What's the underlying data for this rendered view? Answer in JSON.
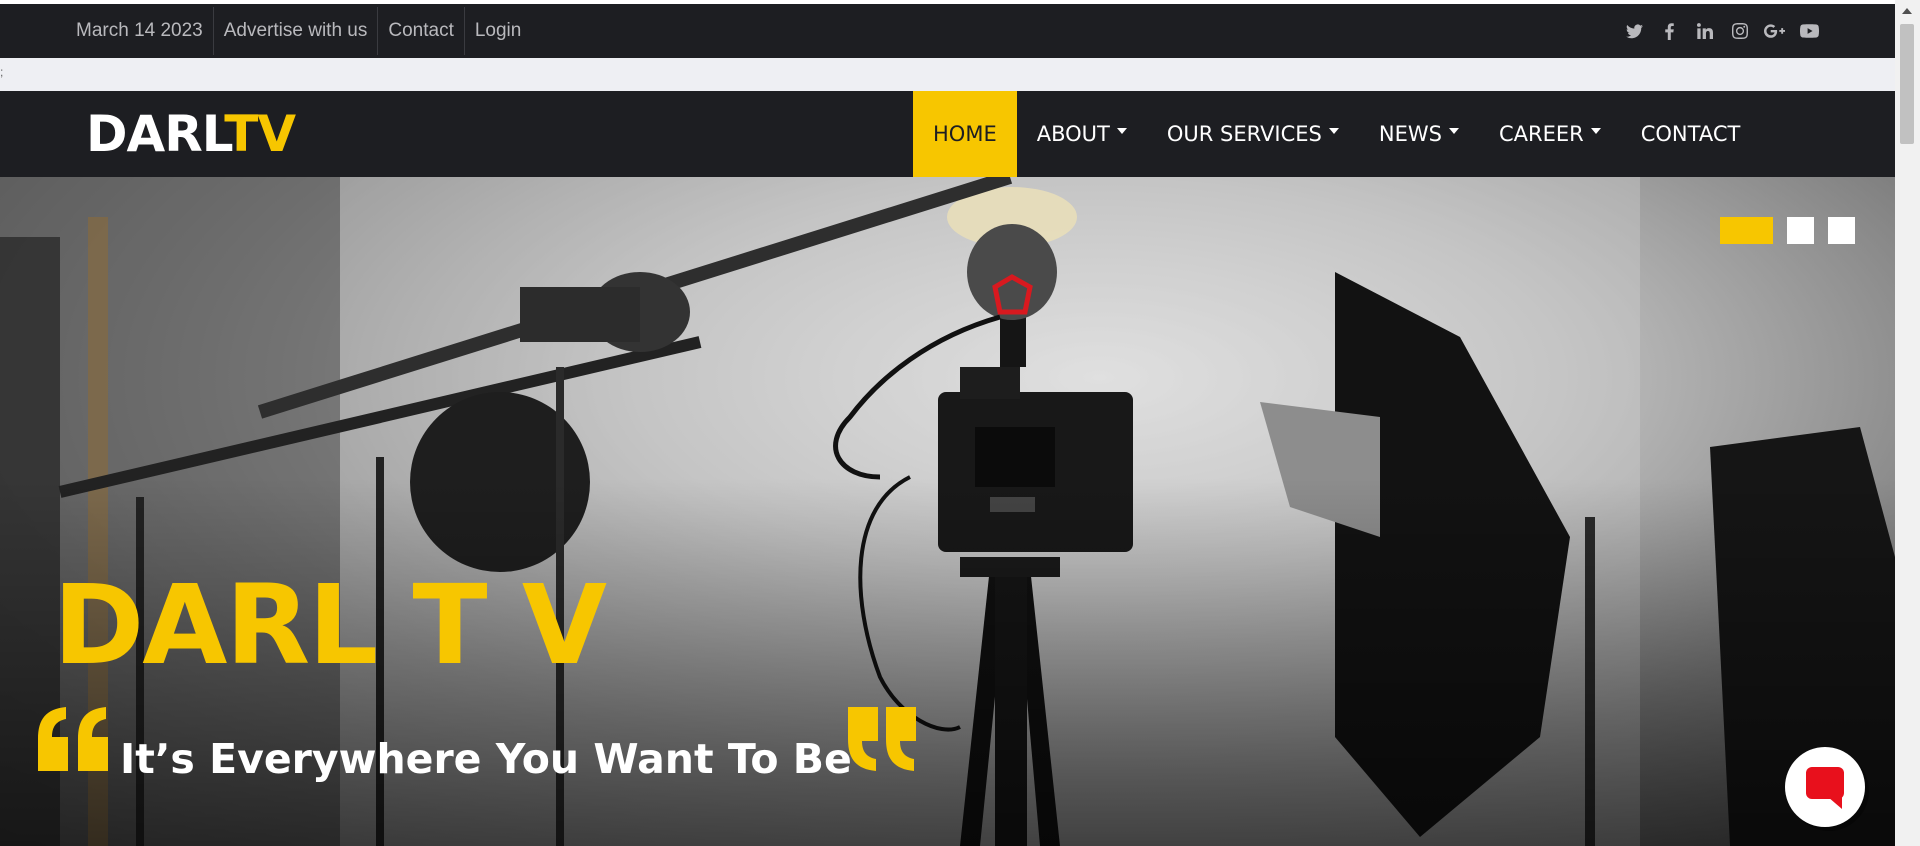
{
  "topbar": {
    "date": "March 14 2023",
    "links": [
      "Advertise with us",
      "Contact",
      "Login"
    ],
    "social_icons": [
      "twitter-icon",
      "facebook-icon",
      "linkedin-icon",
      "instagram-icon",
      "google-plus-icon",
      "youtube-icon"
    ]
  },
  "strip": {
    "text": ";"
  },
  "brand": {
    "part1": "DARL",
    "part2": "TV"
  },
  "nav": {
    "items": [
      {
        "label": "HOME",
        "active": true,
        "dropdown": false
      },
      {
        "label": "ABOUT",
        "active": false,
        "dropdown": true
      },
      {
        "label": "OUR SERVICES",
        "active": false,
        "dropdown": true
      },
      {
        "label": "NEWS",
        "active": false,
        "dropdown": true
      },
      {
        "label": "CAREER",
        "active": false,
        "dropdown": true
      },
      {
        "label": "CONTACT",
        "active": false,
        "dropdown": false
      }
    ]
  },
  "hero": {
    "title": "DARL T V",
    "tagline": "It’s Everywhere You Want To Be",
    "slide_count": 3,
    "active_slide": 1
  },
  "colors": {
    "accent": "#f7c600",
    "dark": "#1d1e22",
    "chat": "#e8101c"
  }
}
